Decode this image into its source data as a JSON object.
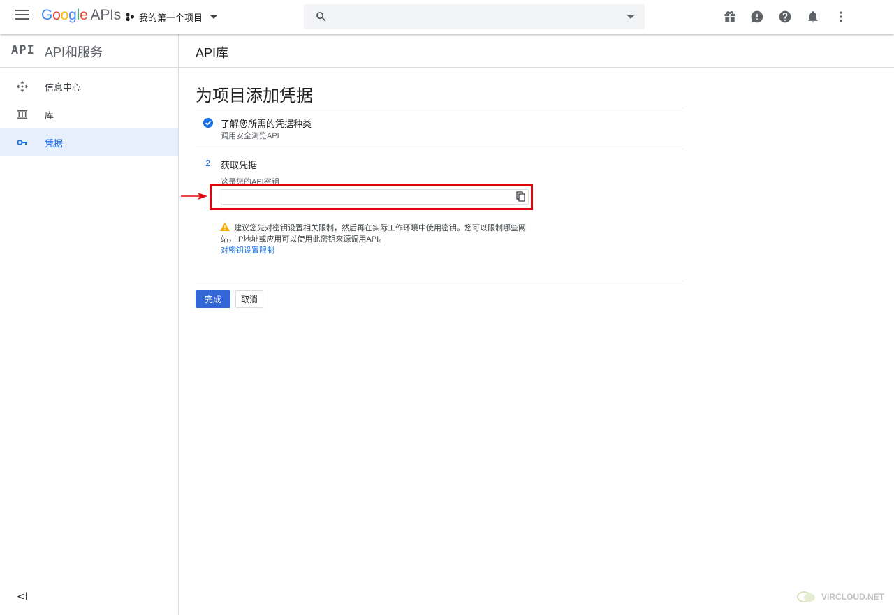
{
  "header": {
    "logo_parts": [
      "G",
      "o",
      "o",
      "g",
      "l",
      "e"
    ],
    "logo_suffix": "APIs",
    "project_name": "我的第一个项目",
    "search_placeholder": "",
    "icons": [
      "gift-icon",
      "feedback-icon",
      "help-icon",
      "notifications-icon",
      "more-vert-icon"
    ]
  },
  "sidebar": {
    "brand_mark": "API",
    "title": "API和服务",
    "items": [
      {
        "label": "信息中心",
        "icon": "dashboard-icon",
        "active": false
      },
      {
        "label": "库",
        "icon": "library-icon",
        "active": false
      },
      {
        "label": "凭据",
        "icon": "key-icon",
        "active": true
      }
    ],
    "collapse_label": "<I"
  },
  "main": {
    "header_title": "API库",
    "page_title": "为项目添加凭据",
    "step1": {
      "title": "了解您所需的凭据种类",
      "subtitle": "调用安全浏览API"
    },
    "step2": {
      "number": "2",
      "title": "获取凭据",
      "key_label": "这是您的API密钥",
      "key_value": ""
    },
    "warning": {
      "text": "建议您先对密钥设置相关限制，然后再在实际工作环境中使用密钥。您可以限制哪些网站，IP地址或应用可以使用此密钥来源调用API。",
      "link": "对密钥设置限制"
    },
    "buttons": {
      "done": "完成",
      "cancel": "取消"
    }
  },
  "watermark": "VIRCLOUD.NET",
  "colors": {
    "primary": "#1a73e8",
    "button_blue": "#3367d6",
    "highlight_red": "#e0040f",
    "warning_yellow": "#f9ab00",
    "active_bg": "#e8f0fe"
  }
}
